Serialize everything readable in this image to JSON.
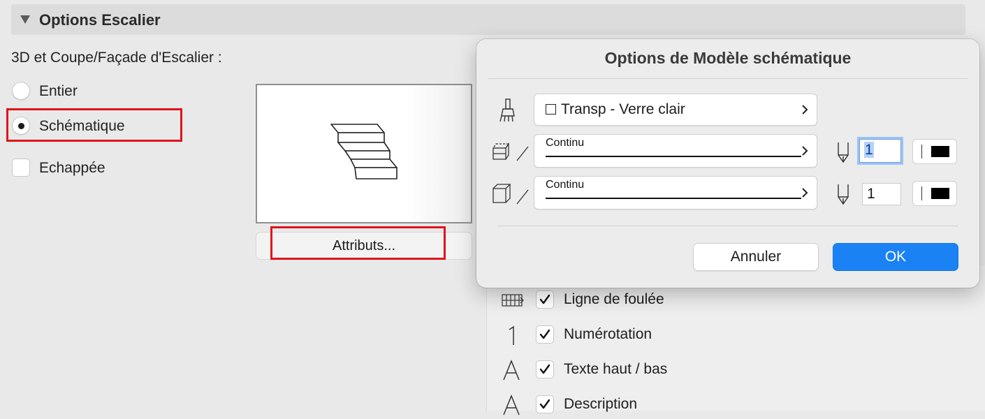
{
  "section": {
    "title": "Options Escalier"
  },
  "stair_display": {
    "label": "3D et Coupe/Façade d'Escalier :",
    "options": [
      {
        "label": "Entier",
        "selected": false
      },
      {
        "label": "Schématique",
        "selected": true
      }
    ],
    "echappee": {
      "label": "Echappée",
      "checked": false
    }
  },
  "attributes_button": {
    "label": "Attributs..."
  },
  "right_options": [
    {
      "label": "Ligne de foulée",
      "checked": true,
      "icon": "walkline-icon"
    },
    {
      "label": "Numérotation",
      "checked": true,
      "icon": "numbering-icon"
    },
    {
      "label": "Texte haut / bas",
      "checked": true,
      "icon": "text-a-icon"
    },
    {
      "label": "Description",
      "checked": true,
      "icon": "text-a-icon"
    }
  ],
  "dialog": {
    "title": "Options de Modèle schématique",
    "material": {
      "label": "Transp - Verre clair"
    },
    "line_rows": [
      {
        "line_type": "Continu",
        "pen": "1",
        "icon": "cut-surface-icon"
      },
      {
        "line_type": "Continu",
        "pen": "1",
        "icon": "box-outline-icon"
      }
    ],
    "buttons": {
      "cancel": "Annuler",
      "ok": "OK"
    },
    "colors": {
      "ok_button": "#1b82f5",
      "focus": "#9bc3f4"
    }
  },
  "colors": {
    "highlight_box": "#e0141a"
  }
}
